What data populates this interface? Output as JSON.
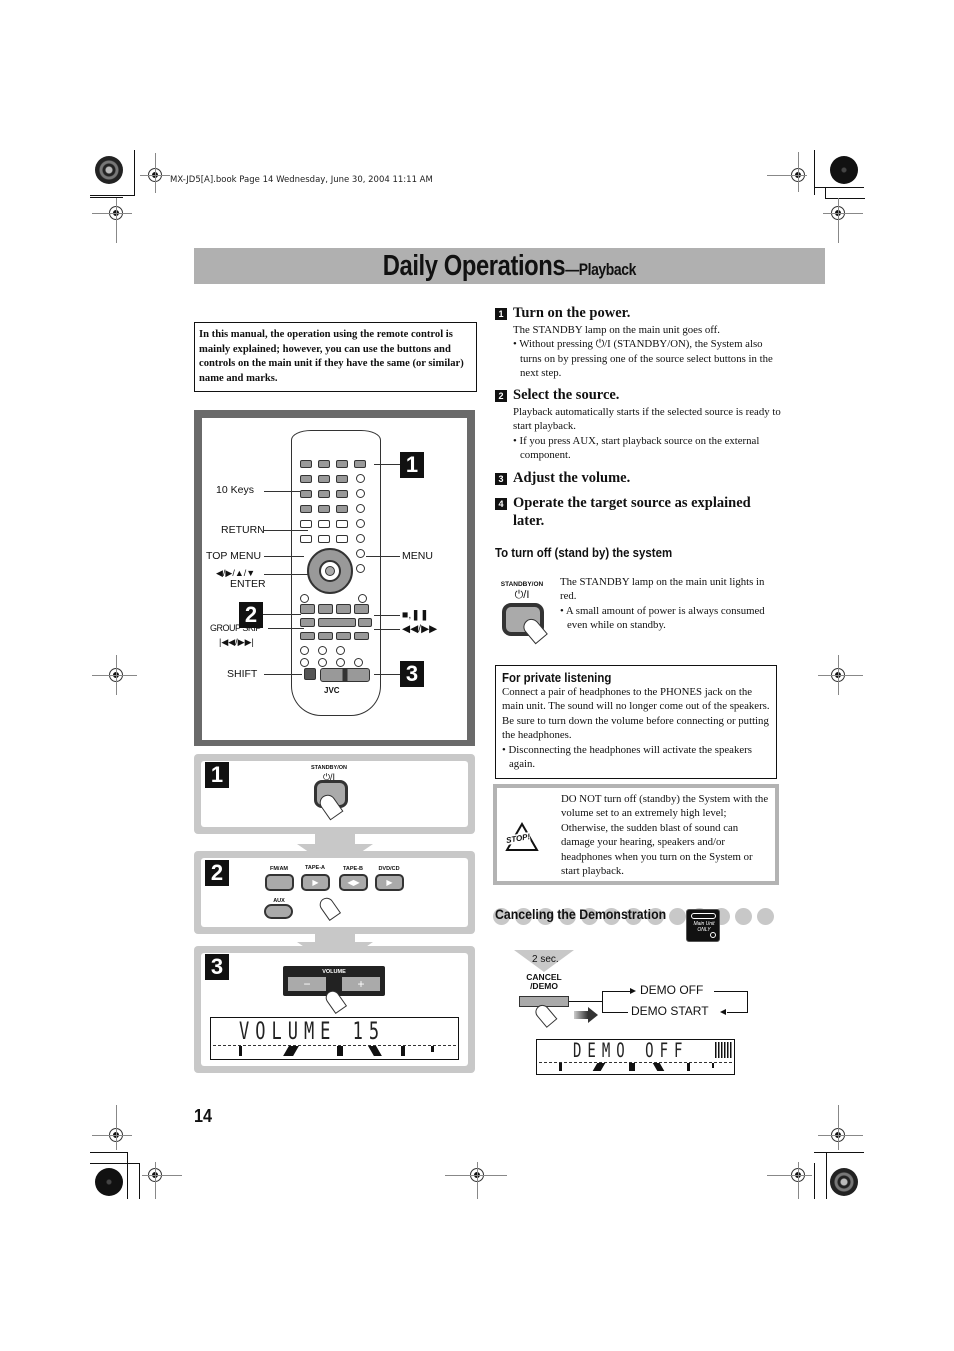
{
  "print_header": "MX-JD5[A].book  Page 14  Wednesday, June 30, 2004  11:11 AM",
  "title": {
    "main": "Daily Operations",
    "sub": "—Playback"
  },
  "note": "In this manual, the operation using the remote control is mainly explained; however, you can use the buttons and controls on the main unit if they have the same (or similar) name and marks.",
  "remote": {
    "labels": {
      "ten_keys": "10 Keys",
      "return": "RETURN",
      "top_menu": "TOP MENU",
      "cursor": "◀/▶/▲/▼",
      "enter": "ENTER",
      "menu": "MENU",
      "group_skip": "GROUP SKIP",
      "skip_arrows": "|◀◀/▶▶|",
      "stop_pause": "■,❚❚",
      "rew_ff": "◀◀/▶▶",
      "shift": "SHIFT",
      "brand": "JVC"
    },
    "callouts": [
      "1",
      "2",
      "3"
    ]
  },
  "steps_diagram": [
    {
      "number": "1",
      "button_label": "STANDBY/ON",
      "symbol": "⏻/I"
    },
    {
      "number": "2",
      "buttons": [
        {
          "label": "FM/AM",
          "glyph": ""
        },
        {
          "label": "TAPE-A",
          "glyph": "▶"
        },
        {
          "label": "TAPE-B",
          "glyph": "◀▶"
        },
        {
          "label": "DVD/CD",
          "glyph": "▶"
        }
      ],
      "aux_label": "AUX"
    },
    {
      "number": "3",
      "volume_label": "VOLUME",
      "minus": "−",
      "plus": "+",
      "display": "VOLUME  15"
    }
  ],
  "steps": [
    {
      "number": "1",
      "heading": "Turn on the power.",
      "body": "The STANDBY lamp on the main unit goes off.",
      "bullets": [
        "Without pressing ⏻/I (STANDBY/ON), the System also turns on by pressing one of the source select buttons in the next step."
      ]
    },
    {
      "number": "2",
      "heading": "Select the source.",
      "body": "Playback automatically starts if the selected source is ready to start playback.",
      "bullets": [
        "If you press AUX, start playback source on the external component."
      ]
    },
    {
      "number": "3",
      "heading": "Adjust the volume."
    },
    {
      "number": "4",
      "heading": "Operate the target source as explained later."
    }
  ],
  "standby": {
    "heading": "To turn off (stand by) the system",
    "button_label": "STANDBY/ON",
    "symbol": "⏻/I",
    "body": "The STANDBY lamp on the main unit lights in red.",
    "bullet": "A small amount of power is always consumed even while on standby."
  },
  "private_listening": {
    "heading": "For private listening",
    "body": "Connect a pair of headphones to the PHONES jack on the main unit. The sound will no longer come out of the speakers. Be sure to turn down the volume before connecting or putting the headphones.",
    "bullet": "Disconnecting the headphones will activate the speakers again."
  },
  "warning": {
    "icon_label": "STOP!",
    "text": "DO NOT turn off (standby) the System with the volume set to an extremely high level; Otherwise, the sudden blast of sound can damage your hearing, speakers and/or headphones when you turn on the System or start playback."
  },
  "demo": {
    "heading": "Canceling the Demonstration",
    "badge": "Main Unit ONLY",
    "hold": "2 sec.",
    "button_label": "CANCEL /DEMO",
    "option_off": "DEMO OFF",
    "option_start": "DEMO START",
    "display": "DEMO  OFF"
  },
  "page_number": "14"
}
